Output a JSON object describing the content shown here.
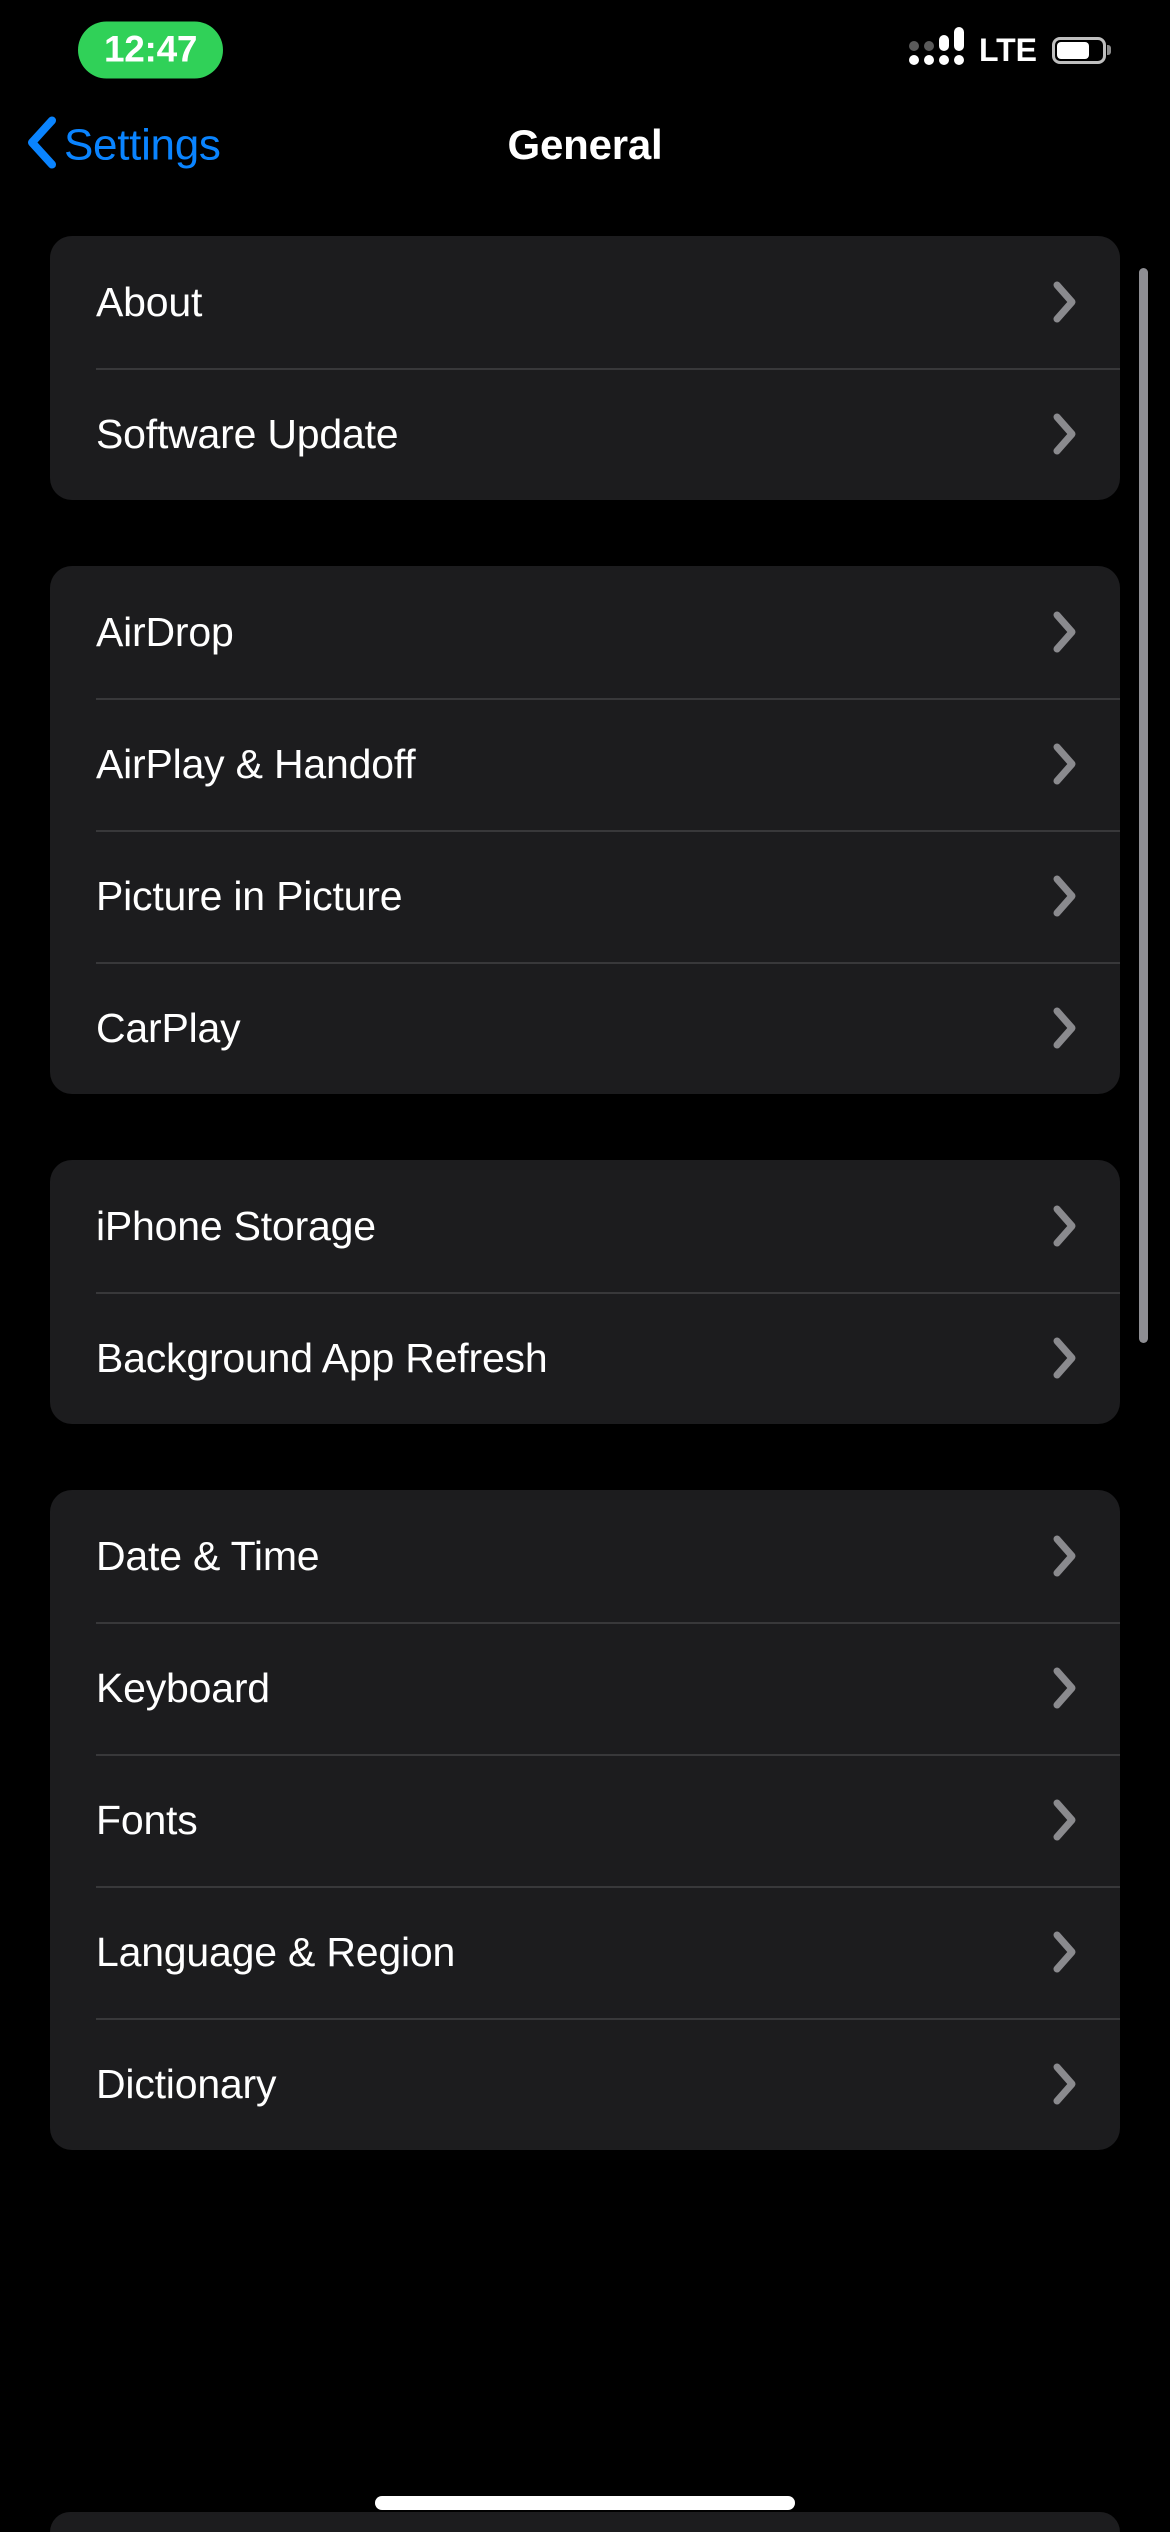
{
  "status_bar": {
    "time": "12:47",
    "time_pill_color": "#30D158",
    "carrier_label": "LTE",
    "signal_icon": "signal-bars-icon",
    "signal_strength": 4,
    "battery_icon": "battery-icon",
    "battery_level_percent": 72
  },
  "nav": {
    "back_icon": "chevron-left-icon",
    "back_label": "Settings",
    "title": "General",
    "accent_color": "#0A84FF"
  },
  "list": {
    "chevron_icon": "chevron-right-icon",
    "group_background": "#1C1C1E",
    "separator_color": "#38383A",
    "groups": [
      {
        "rows": [
          {
            "label": "About"
          },
          {
            "label": "Software Update"
          }
        ]
      },
      {
        "rows": [
          {
            "label": "AirDrop"
          },
          {
            "label": "AirPlay & Handoff"
          },
          {
            "label": "Picture in Picture"
          },
          {
            "label": "CarPlay"
          }
        ]
      },
      {
        "rows": [
          {
            "label": "iPhone Storage"
          },
          {
            "label": "Background App Refresh"
          }
        ]
      },
      {
        "rows": [
          {
            "label": "Date & Time"
          },
          {
            "label": "Keyboard"
          },
          {
            "label": "Fonts"
          },
          {
            "label": "Language & Region"
          },
          {
            "label": "Dictionary"
          }
        ]
      }
    ]
  },
  "scrollbar": {
    "color": "#8E8E93"
  },
  "home_indicator": {
    "color": "#FFFFFF"
  }
}
